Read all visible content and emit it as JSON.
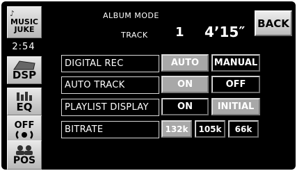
{
  "sidebar": {
    "music_juke": [
      "MUSIC",
      "JUKE"
    ],
    "clock": "2:54",
    "dsp": "DSP",
    "eq": "EQ",
    "off": "OFF",
    "pos": "POS"
  },
  "header": {
    "mode": "ALBUM MODE",
    "track_label": "TRACK",
    "track_number": "1",
    "track_time": "4’15″",
    "back": "BACK"
  },
  "settings": {
    "digital_rec": {
      "label": "DIGITAL REC",
      "options": [
        "AUTO",
        "MANUAL"
      ],
      "selected": "AUTO"
    },
    "auto_track": {
      "label": "AUTO TRACK",
      "options": [
        "ON",
        "OFF"
      ],
      "selected": "ON"
    },
    "playlist_display": {
      "label": "PLAYLIST DISPLAY",
      "options": [
        "ON",
        "INITIAL"
      ],
      "selected": "INITIAL"
    },
    "bitrate": {
      "label": "BITRATE",
      "options": [
        "132k",
        "105k",
        "66k"
      ],
      "selected": "132k"
    }
  }
}
